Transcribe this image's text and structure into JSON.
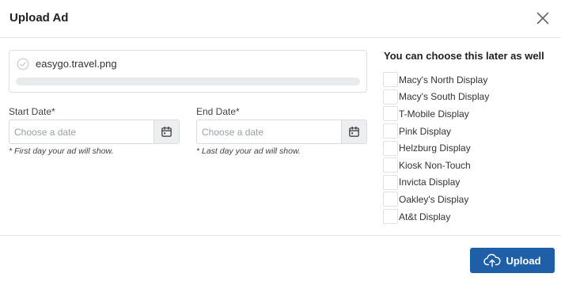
{
  "dialog": {
    "title": "Upload Ad",
    "close_icon": "close-icon"
  },
  "file": {
    "name": "easygo.travel.png",
    "status_icon": "check-circle-icon",
    "progress": 0
  },
  "start_date": {
    "label": "Start Date*",
    "placeholder": "Choose a date",
    "value": "",
    "hint": "* First day your ad will show.",
    "icon": "calendar-icon"
  },
  "end_date": {
    "label": "End Date*",
    "placeholder": "Choose a date",
    "value": "",
    "hint": "* Last day your ad will show.",
    "icon": "calendar-icon"
  },
  "displays": {
    "title": "You can choose this later as well",
    "items": [
      {
        "label": "Macy's North Display",
        "checked": false
      },
      {
        "label": "Macy's South Display",
        "checked": false
      },
      {
        "label": "T-Mobile Display",
        "checked": false
      },
      {
        "label": "Pink Display",
        "checked": false
      },
      {
        "label": "Helzburg Display",
        "checked": false
      },
      {
        "label": "Kiosk Non-Touch",
        "checked": false
      },
      {
        "label": "Invicta Display",
        "checked": false
      },
      {
        "label": "Oakley's Display",
        "checked": false
      },
      {
        "label": "At&t Display",
        "checked": false
      }
    ]
  },
  "footer": {
    "upload_label": "Upload",
    "upload_icon": "cloud-upload-icon"
  },
  "colors": {
    "primary": "#1e5fa8",
    "border": "#dcdfe4",
    "progress_track": "#e9eaec"
  }
}
